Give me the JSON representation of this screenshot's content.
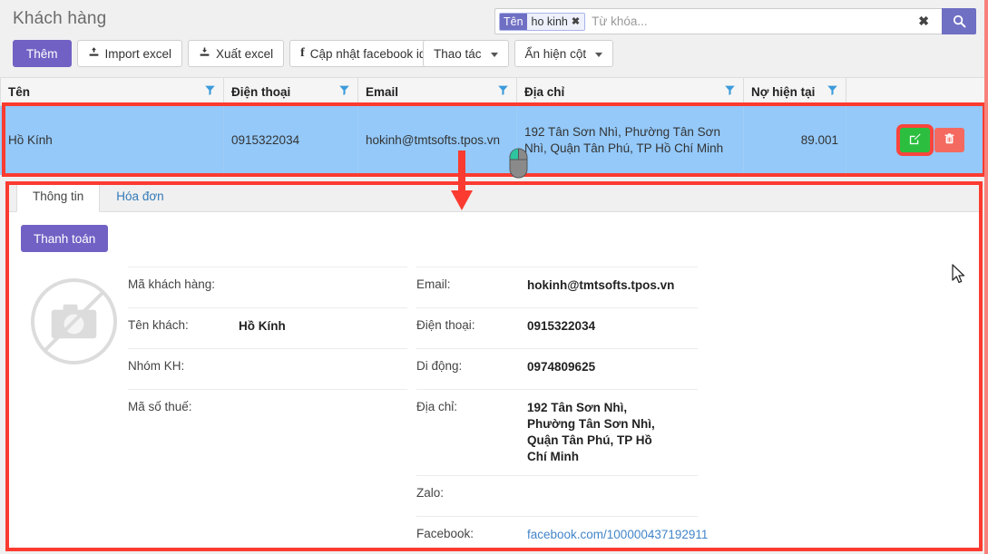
{
  "header": {
    "title": "Khách hàng"
  },
  "search": {
    "tag_key": "Tên",
    "tag_value": "ho kinh",
    "tag_remove_icon": "✖",
    "placeholder": "Từ khóa...",
    "value": "",
    "clear_icon": "✖",
    "search_icon": "search-icon"
  },
  "toolbar": {
    "add_label": "Thêm",
    "import_label": "Import excel",
    "export_label": "Xuất excel",
    "facebook_label": "Cập nhật facebook id",
    "facebook_icon": "f",
    "action_label": "Thao tác",
    "columns_label": "Ẩn hiện cột"
  },
  "table": {
    "columns": [
      {
        "label": "Tên",
        "filter": true
      },
      {
        "label": "Điện thoại",
        "filter": true
      },
      {
        "label": "Email",
        "filter": true
      },
      {
        "label": "Địa chỉ",
        "filter": true
      },
      {
        "label": "Nợ hiện tại",
        "filter": true
      },
      {
        "label": "",
        "filter": false
      }
    ],
    "rows": [
      {
        "name": "Hồ Kính",
        "phone": "0915322034",
        "email": "hokinh@tmtsofts.tpos.vn",
        "address": "192 Tân Sơn Nhì, Phường Tân Sơn Nhì, Quận Tân Phú, TP Hồ Chí Minh",
        "debt": "89.001",
        "edit_icon": "edit-icon",
        "delete_icon": "trash-icon"
      }
    ]
  },
  "detail": {
    "tabs": [
      {
        "label": "Thông tin",
        "active": true
      },
      {
        "label": "Hóa đơn",
        "active": false
      }
    ],
    "pay_label": "Thanh toán",
    "avatar_icon": "no-photo-icon",
    "left_fields": [
      {
        "label": "Mã khách hàng:",
        "value": ""
      },
      {
        "label": "Tên khách:",
        "value": "Hồ Kính"
      },
      {
        "label": "Nhóm KH:",
        "value": ""
      },
      {
        "label": "Mã số thuế:",
        "value": ""
      }
    ],
    "right_fields": [
      {
        "label": "Email:",
        "value": "hokinh@tmtsofts.tpos.vn",
        "link": false
      },
      {
        "label": "Điện thoại:",
        "value": "0915322034",
        "link": false
      },
      {
        "label": "Di động:",
        "value": "0974809625",
        "link": false
      },
      {
        "label": "Địa chỉ:",
        "value": "192 Tân Sơn Nhì, Phường Tân Sơn Nhì, Quận Tân Phú, TP Hồ Chí Minh",
        "link": false
      },
      {
        "label": "Zalo:",
        "value": "",
        "link": false
      },
      {
        "label": "Facebook:",
        "value": "facebook.com/100000437192911",
        "link": true
      }
    ]
  },
  "annotations": {
    "row_highlight_color": "#fb3b30",
    "panel_highlight_color": "#fb3b30",
    "arrow_icon": "down-arrow-annotation",
    "mouse_icon": "mouse-click-icon",
    "cursor_icon": "cursor-arrow-icon"
  },
  "colors": {
    "accent": "#7161c4",
    "row_selected": "#94c9fa",
    "edit_green": "#2cbf3f",
    "delete_red": "#f46a60",
    "link_blue": "#4285c9"
  }
}
